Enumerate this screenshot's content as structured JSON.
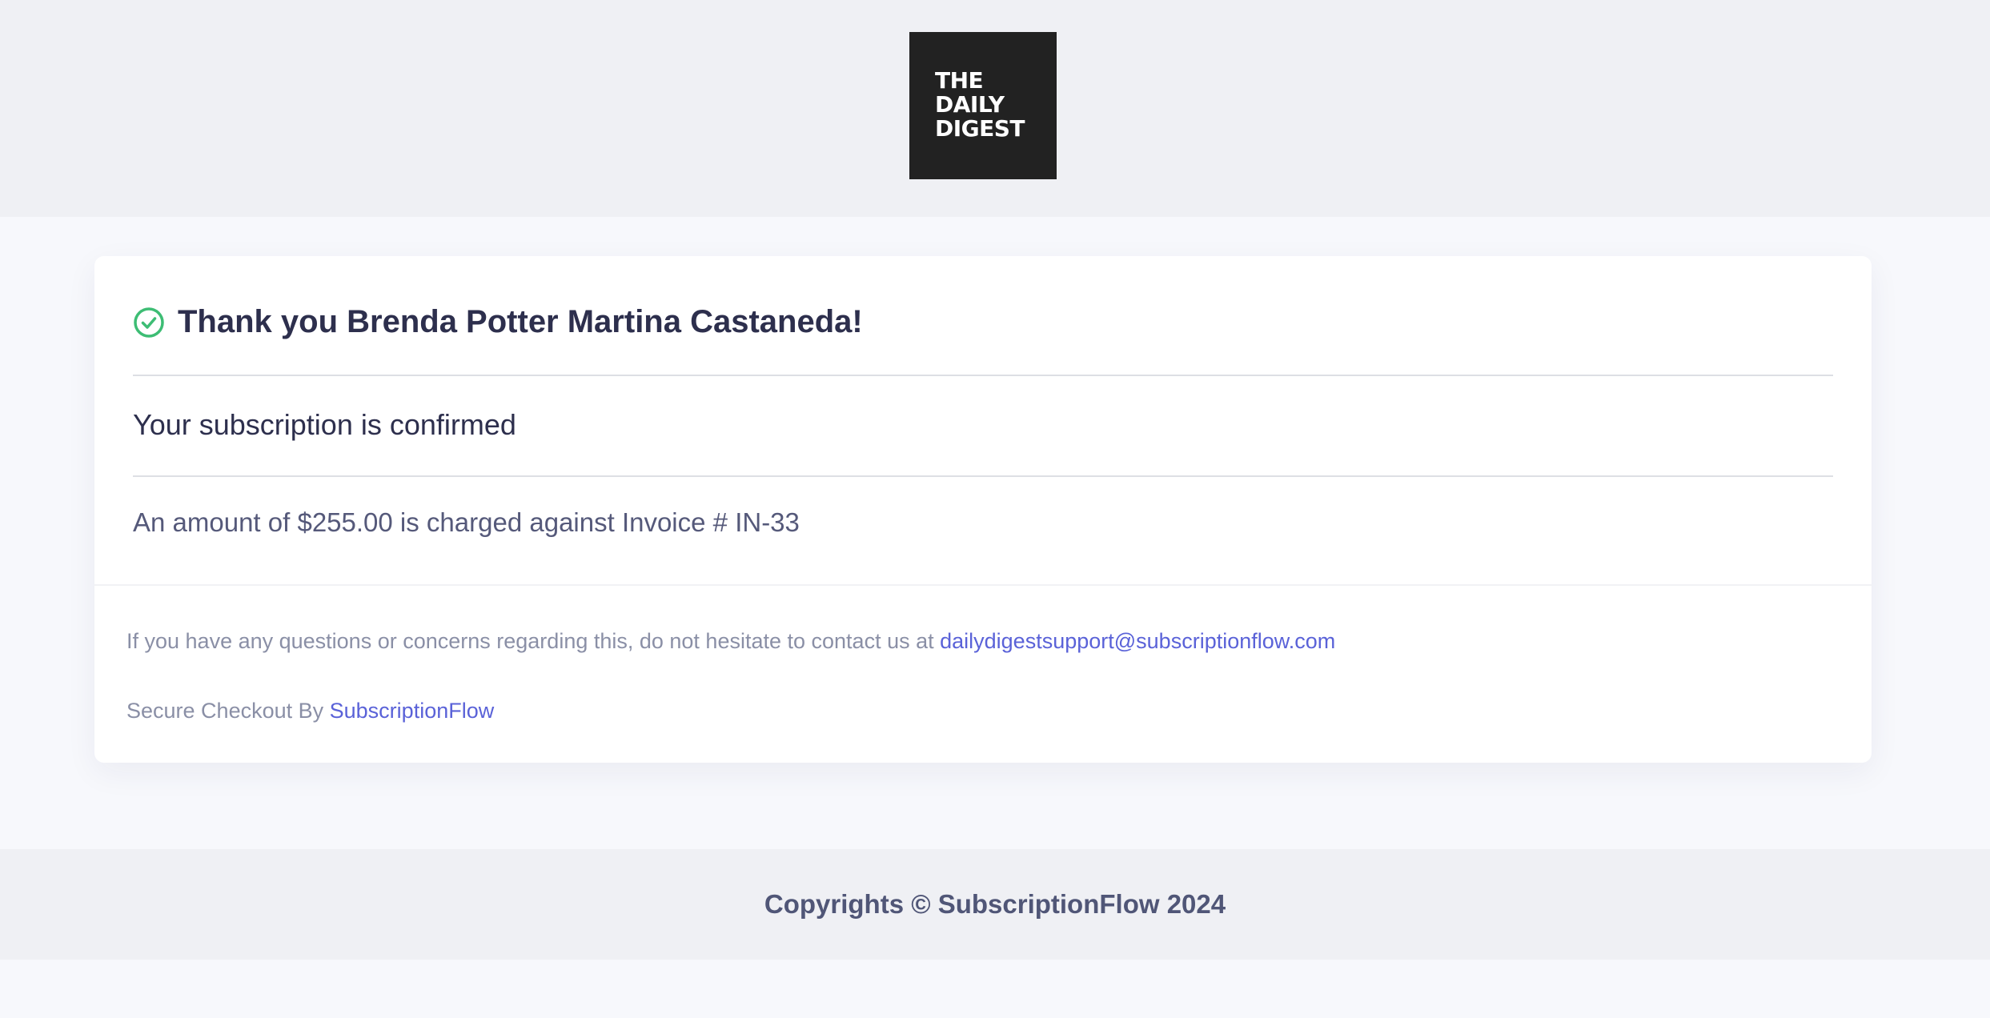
{
  "header": {
    "logo_lines": [
      "THE",
      "DAILY",
      "DIGEST"
    ]
  },
  "confirmation": {
    "thanks_title": "Thank you Brenda Potter Martina Castaneda!",
    "subscription_status": "Your subscription is confirmed",
    "amount_prefix": "An amount of ",
    "amount": "$255.00",
    "amount_middle": " is charged against Invoice # ",
    "invoice_number": "IN-33",
    "check_icon": "check-circle-icon",
    "check_color": "#3dbd74"
  },
  "support": {
    "questions_text": "If you have any questions or concerns regarding this, do not hesitate to contact us at ",
    "email": "dailydigestsupport@subscriptionflow.com",
    "secure_prefix": "Secure Checkout By ",
    "secure_link": "SubscriptionFlow",
    "link_color": "#5a62d8"
  },
  "footer": {
    "copyright": "Copyrights © SubscriptionFlow 2024"
  }
}
